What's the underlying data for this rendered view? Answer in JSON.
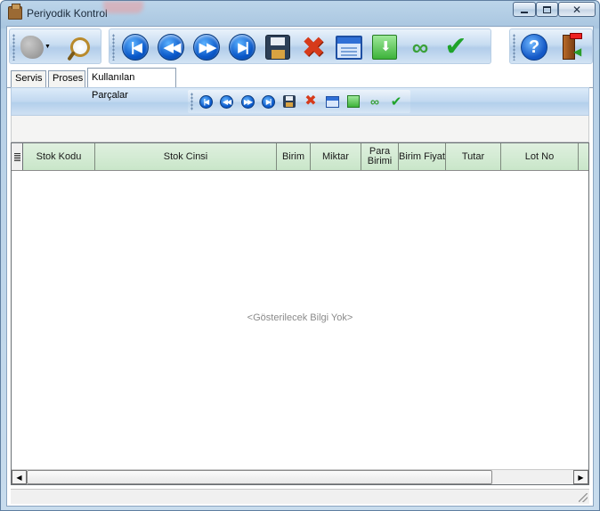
{
  "window": {
    "title": "Periyodik Kontrol",
    "min_icon": "minimize-icon",
    "max_icon": "maximize-icon",
    "close_icon": "close-icon"
  },
  "main_toolbar": {
    "icons": [
      "shape-icon",
      "magnifier-icon",
      "first-record-icon",
      "previous-record-icon",
      "next-record-icon",
      "last-record-icon",
      "save-icon",
      "delete-icon",
      "window-icon",
      "export-icon",
      "link-icon",
      "confirm-icon",
      "help-icon",
      "exit-icon"
    ]
  },
  "tabs": [
    {
      "label": "Servis",
      "active": false
    },
    {
      "label": "Proses",
      "active": false
    },
    {
      "label": "Kullanılan Parçalar",
      "active": true
    }
  ],
  "inner_toolbar": {
    "icons": [
      "first-record-icon",
      "previous-record-icon",
      "next-record-icon",
      "last-record-icon",
      "save-icon",
      "delete-icon",
      "window-icon",
      "export-icon",
      "link-icon",
      "confirm-icon"
    ]
  },
  "grid": {
    "columns": [
      "Stok Kodu",
      "Stok Cinsi",
      "Birim",
      "Miktar",
      "Para Birimi",
      "Birim Fiyat",
      "Tutar",
      "Lot No"
    ],
    "rows": [],
    "empty_text": "<Gösterilecek Bilgi Yok>"
  },
  "colors": {
    "header_green": "#cfe8cf",
    "toolbar_blue": "#c1d8f0",
    "title_bar": "#a9c6e0"
  }
}
